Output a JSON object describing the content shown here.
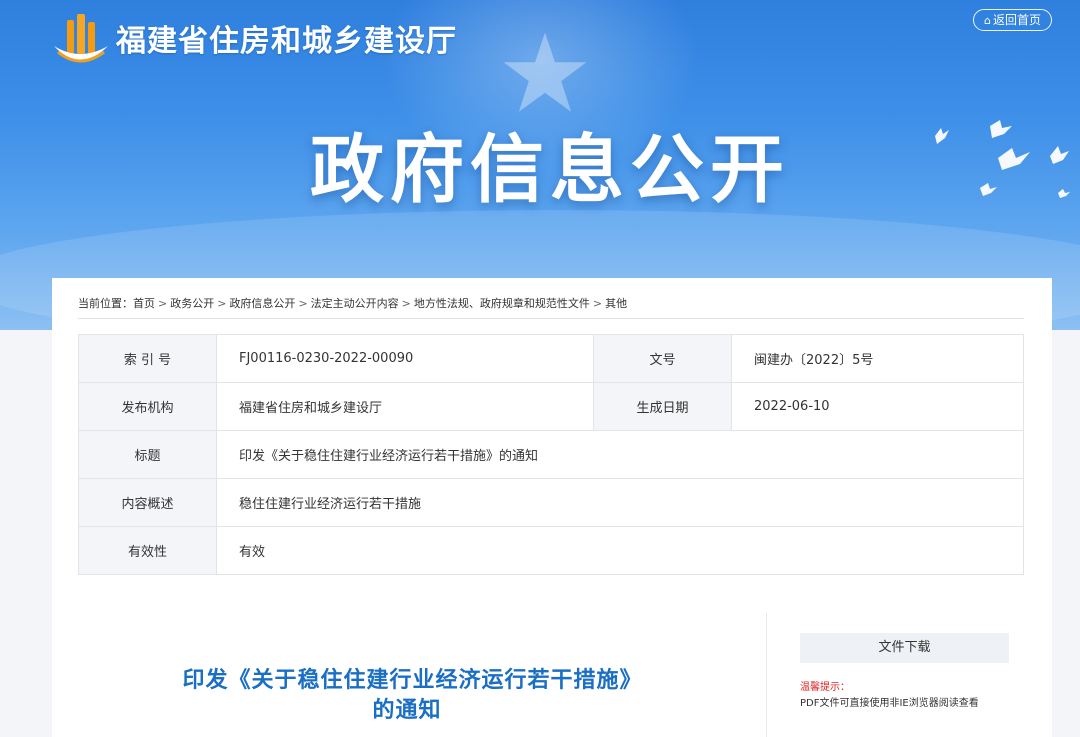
{
  "header": {
    "site_name": "福建省住房和城乡建设厅",
    "home_button": "返回首页",
    "hero_title": "政府信息公开",
    "brand_color": "#3a8be6"
  },
  "breadcrumb": {
    "prefix": "当前位置：",
    "items": [
      "首页",
      "政务公开",
      "政府信息公开",
      "法定主动公开内容",
      "地方性法规、政府规章和规范性文件",
      "其他"
    ],
    "separator": ">"
  },
  "meta_table": {
    "index_label": "索 引 号",
    "index_value": "FJ00116-0230-2022-00090",
    "doc_no_label": "文号",
    "doc_no_value": "闽建办〔2022〕5号",
    "publisher_label": "发布机构",
    "publisher_value": "福建省住房和城乡建设厅",
    "date_label": "生成日期",
    "date_value": "2022-06-10",
    "title_label": "标题",
    "title_value": "印发《关于稳住住建行业经济运行若干措施》的通知",
    "summary_label": "内容概述",
    "summary_value": "稳住住建行业经济运行若干措施",
    "validity_label": "有效性",
    "validity_value": "有效"
  },
  "document": {
    "title": "印发《关于稳住住建行业经济运行若干措施》的通知"
  },
  "sidebar": {
    "download_label": "文件下载",
    "tip_label": "温馨提示：",
    "tip_text": "PDF文件可直接使用非IE浏览器阅读查看"
  }
}
